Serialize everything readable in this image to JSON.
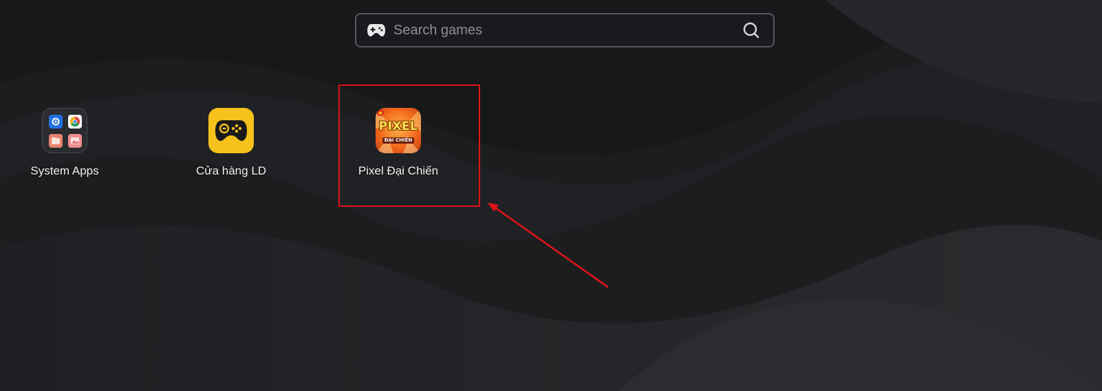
{
  "search": {
    "placeholder": "Search games",
    "icon_left": "gamepad-icon",
    "icon_right": "search-icon"
  },
  "apps": [
    {
      "label": "System Apps",
      "icon": "folder-icon"
    },
    {
      "label": "Cửa hàng LD",
      "icon": "ld-store-icon"
    },
    {
      "label": "Pixel Đại Chiến",
      "icon": "pixel-dai-chien-icon",
      "logo_text": "PIXEL",
      "logo_subtext": "ĐẠI CHIẾN"
    }
  ],
  "annotation": {
    "color": "#e0141b",
    "target": "Pixel Đại Chiến"
  },
  "colors": {
    "background": "#1b1c1e",
    "ld_store_yellow": "#f6c11b",
    "pixel_orange": "#f26a1b"
  }
}
